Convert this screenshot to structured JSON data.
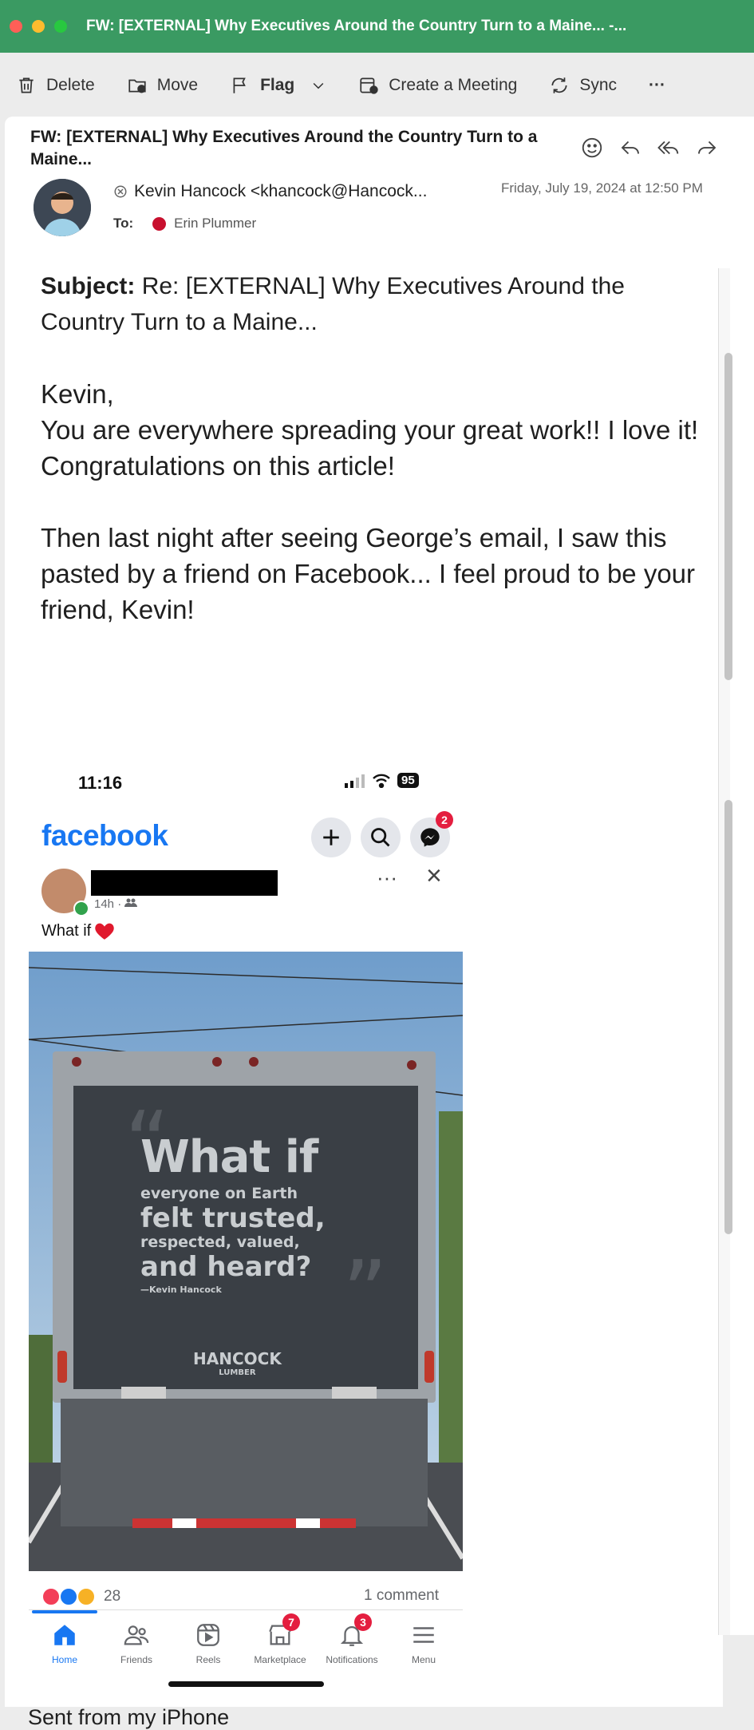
{
  "window": {
    "title": "FW: [EXTERNAL] Why Executives Around the Country Turn to a Maine... -..."
  },
  "toolbar": {
    "delete": "Delete",
    "move": "Move",
    "flag": "Flag",
    "create_meeting": "Create a Meeting",
    "sync": "Sync",
    "more": "···"
  },
  "email": {
    "subject": "FW: [EXTERNAL] Why Executives Around the Country Turn to a Maine...",
    "sender": "Kevin Hancock <khancock@Hancock...",
    "date": "Friday, July 19, 2024 at 12:50 PM",
    "to_label": "To:",
    "recipient": "Erin Plummer",
    "body": {
      "subject_label": "Subject:",
      "subject_text": "Re: [EXTERNAL] Why Executives Around the Country Turn to a Maine...",
      "greeting": "Kevin,",
      "para1": "You are everywhere spreading your great work!! I love it! Congratulations on this article!",
      "para2": "Then last night after seeing George’s email, I saw this pasted by a friend on Facebook...  I feel proud to be your friend, Kevin!",
      "signature": "Sent from my iPhone"
    }
  },
  "facebook_screenshot": {
    "status_time": "11:16",
    "battery": "95",
    "logo": "facebook",
    "messenger_badge": "2",
    "post_time": "14h ·",
    "post_text": "What if",
    "reaction_count": "28",
    "comment_count": "1 comment",
    "nav": [
      {
        "label": "Home",
        "badge": ""
      },
      {
        "label": "Friends",
        "badge": ""
      },
      {
        "label": "Reels",
        "badge": ""
      },
      {
        "label": "Marketplace",
        "badge": "7"
      },
      {
        "label": "Notifications",
        "badge": "3"
      },
      {
        "label": "Menu",
        "badge": ""
      }
    ],
    "truck": {
      "headline": "What if",
      "line2": "everyone on Earth",
      "line3": "felt trusted,",
      "line4": "respected, valued,",
      "line5": "and heard?",
      "attribution": "—Kevin Hancock",
      "brand": "HANCOCK",
      "brand_sub": "LUMBER"
    }
  },
  "colors": {
    "titlebar": "#3a9a62",
    "facebook_blue": "#1877f2",
    "badge_red": "#e41e3f"
  }
}
